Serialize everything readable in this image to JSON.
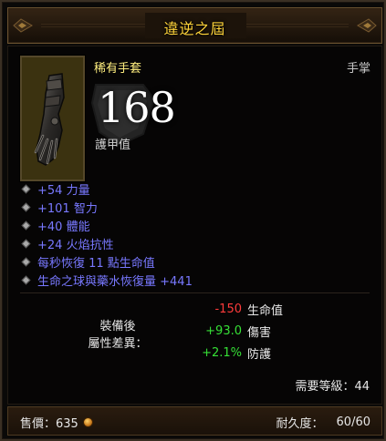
{
  "item": {
    "title": "違逆之屆",
    "name": "稀有手套",
    "slot_type": "手掌",
    "armor_value": "168",
    "armor_label": "護甲值",
    "icon": "gauntlet-icon"
  },
  "affixes": [
    "+54 力量",
    "+101 智力",
    "+40 體能",
    "+24 火焰抗性",
    "每秒恢復 11 點生命值",
    "生命之球與藥水恢復量 +441"
  ],
  "comparison": {
    "label_line1": "裝備後",
    "label_line2": "屬性差異：",
    "rows": [
      {
        "value": "-150",
        "stat": "生命值",
        "sign": "neg"
      },
      {
        "value": "+93.0",
        "stat": "傷害",
        "sign": "pos"
      },
      {
        "value": "+2.1%",
        "stat": "防護",
        "sign": "pos"
      }
    ]
  },
  "requirement": "需要等級：44",
  "footer": {
    "sell_label": "售價：635",
    "durability_label": "耐久度：",
    "durability_value": "60/60"
  },
  "colors": {
    "title": "#ffd43a",
    "rare_name": "#ffef7f",
    "affix": "#7878ff",
    "negative": "#ff3b3b",
    "positive": "#36e036"
  }
}
